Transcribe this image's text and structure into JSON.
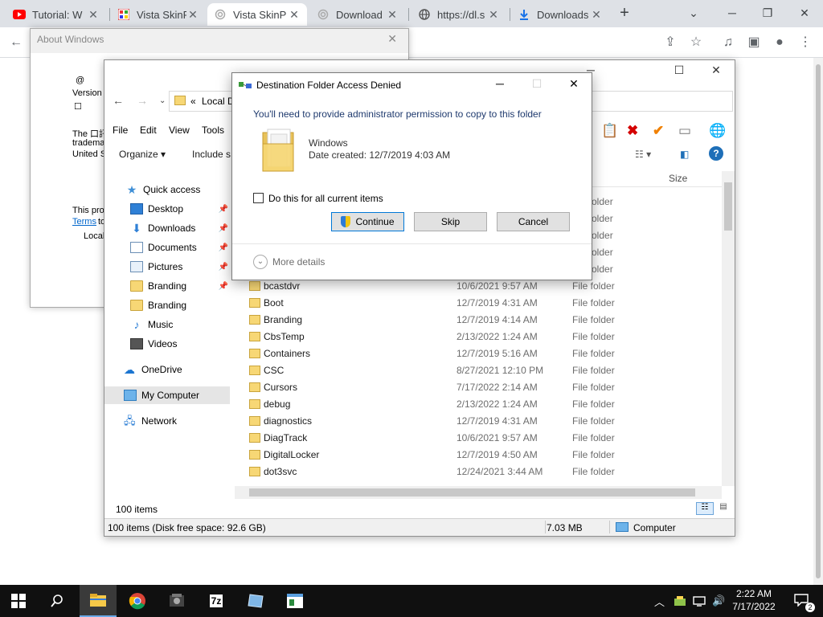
{
  "browser": {
    "tabs": [
      {
        "title": "Tutorial: W",
        "icon": "youtube-icon",
        "active": false
      },
      {
        "title": "Vista SkinP",
        "icon": "app-icon",
        "active": false
      },
      {
        "title": "Vista SkinP",
        "icon": "loading-icon",
        "active": true
      },
      {
        "title": "Download",
        "icon": "loading-icon",
        "active": false
      },
      {
        "title": "https://dl.s",
        "icon": "globe-icon",
        "active": false
      },
      {
        "title": "Downloads",
        "icon": "download-icon",
        "active": false
      }
    ]
  },
  "about_windows": {
    "title": "About Windows",
    "line_symbol": "@",
    "version": "Version",
    "box_char": "☐",
    "trademark_line1": "The 口訊",
    "trademark_line2": "tradema",
    "trademark_line3": "United S",
    "product_line": "This proc",
    "terms_link": "Terms",
    "terms_suffix": "to",
    "local_text": "Local"
  },
  "explorer": {
    "address_prefix": "«",
    "address_crumb": "Local D",
    "menu": [
      "File",
      "Edit",
      "View",
      "Tools"
    ],
    "organize": "Organize ▾",
    "include": "Include s",
    "nav": [
      {
        "label": "Quick access",
        "icon": "star-icon",
        "pinned": false
      },
      {
        "label": "Desktop",
        "icon": "desktop-icon",
        "pinned": true
      },
      {
        "label": "Downloads",
        "icon": "downloads-icon",
        "pinned": true
      },
      {
        "label": "Documents",
        "icon": "documents-icon",
        "pinned": true
      },
      {
        "label": "Pictures",
        "icon": "pictures-icon",
        "pinned": true
      },
      {
        "label": "Branding",
        "icon": "folder-icon",
        "pinned": true
      },
      {
        "label": "Branding",
        "icon": "folder-icon",
        "pinned": false
      },
      {
        "label": "Music",
        "icon": "music-icon",
        "pinned": false
      },
      {
        "label": "Videos",
        "icon": "videos-icon",
        "pinned": false
      },
      {
        "label": "OneDrive",
        "icon": "onedrive-icon",
        "pinned": false
      },
      {
        "label": "My Computer",
        "icon": "computer-icon",
        "pinned": false,
        "selected": true
      },
      {
        "label": "Network",
        "icon": "network-icon",
        "pinned": false
      }
    ],
    "column_size": "Size",
    "rows": [
      {
        "name": "",
        "date": "",
        "type": "older"
      },
      {
        "name": "",
        "date": "",
        "type": "older"
      },
      {
        "name": "",
        "date": "",
        "type": "older"
      },
      {
        "name": "",
        "date": "",
        "type": "older"
      },
      {
        "name": "",
        "date": "",
        "type": "older"
      },
      {
        "name": "bcastdvr",
        "date": "10/6/2021 9:57 AM",
        "type": "File folder"
      },
      {
        "name": "Boot",
        "date": "12/7/2019 4:31 AM",
        "type": "File folder"
      },
      {
        "name": "Branding",
        "date": "12/7/2019 4:14 AM",
        "type": "File folder"
      },
      {
        "name": "CbsTemp",
        "date": "2/13/2022 1:24 AM",
        "type": "File folder"
      },
      {
        "name": "Containers",
        "date": "12/7/2019 5:16 AM",
        "type": "File folder"
      },
      {
        "name": "CSC",
        "date": "8/27/2021 12:10 PM",
        "type": "File folder"
      },
      {
        "name": "Cursors",
        "date": "7/17/2022 2:14 AM",
        "type": "File folder"
      },
      {
        "name": "debug",
        "date": "2/13/2022 1:24 AM",
        "type": "File folder"
      },
      {
        "name": "diagnostics",
        "date": "12/7/2019 4:31 AM",
        "type": "File folder"
      },
      {
        "name": "DiagTrack",
        "date": "10/6/2021 9:57 AM",
        "type": "File folder"
      },
      {
        "name": "DigitalLocker",
        "date": "12/7/2019 4:50 AM",
        "type": "File folder"
      },
      {
        "name": "dot3svc",
        "date": "12/24/2021 3:44 AM",
        "type": "File folder"
      }
    ],
    "item_count": "100 items",
    "status_left": "100 items (Disk free space: 92.6 GB)",
    "status_size": "7.03 MB",
    "status_location": "Computer"
  },
  "copy_dialog": {
    "title": "Destination Folder Access Denied",
    "message": "You'll need to provide administrator permission to copy to this folder",
    "folder_name": "Windows",
    "folder_date": "Date created: 12/7/2019 4:03 AM",
    "checkbox_label": "Do this for all current items",
    "continue_label": "Continue",
    "skip_label": "Skip",
    "cancel_label": "Cancel",
    "more_details": "More details"
  },
  "taskbar": {
    "time": "2:22 AM",
    "date": "7/17/2022",
    "notifications": "2"
  }
}
